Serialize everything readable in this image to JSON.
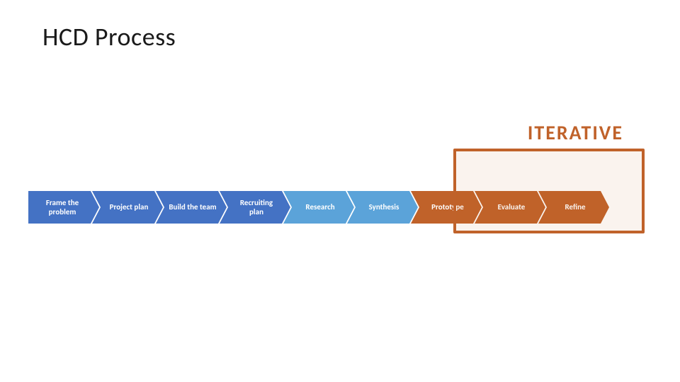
{
  "title": "HCD Process",
  "iterative_label": "ITERATIVE",
  "arrows": [
    {
      "id": "frame",
      "label": "Frame the problem",
      "color": "blue",
      "first": true
    },
    {
      "id": "project",
      "label": "Project plan",
      "color": "blue",
      "first": false
    },
    {
      "id": "build",
      "label": "Build the team",
      "color": "blue",
      "first": false
    },
    {
      "id": "recruiting",
      "label": "Recruiting plan",
      "color": "blue",
      "first": false
    },
    {
      "id": "research",
      "label": "Research",
      "color": "light-blue",
      "first": false
    },
    {
      "id": "synthesis",
      "label": "Synthesis",
      "color": "light-blue",
      "first": false
    },
    {
      "id": "prototype",
      "label": "Prototype",
      "color": "orange",
      "first": false
    },
    {
      "id": "evaluate",
      "label": "Evaluate",
      "color": "orange",
      "first": false
    },
    {
      "id": "refine",
      "label": "Refine",
      "color": "orange",
      "first": false
    }
  ]
}
